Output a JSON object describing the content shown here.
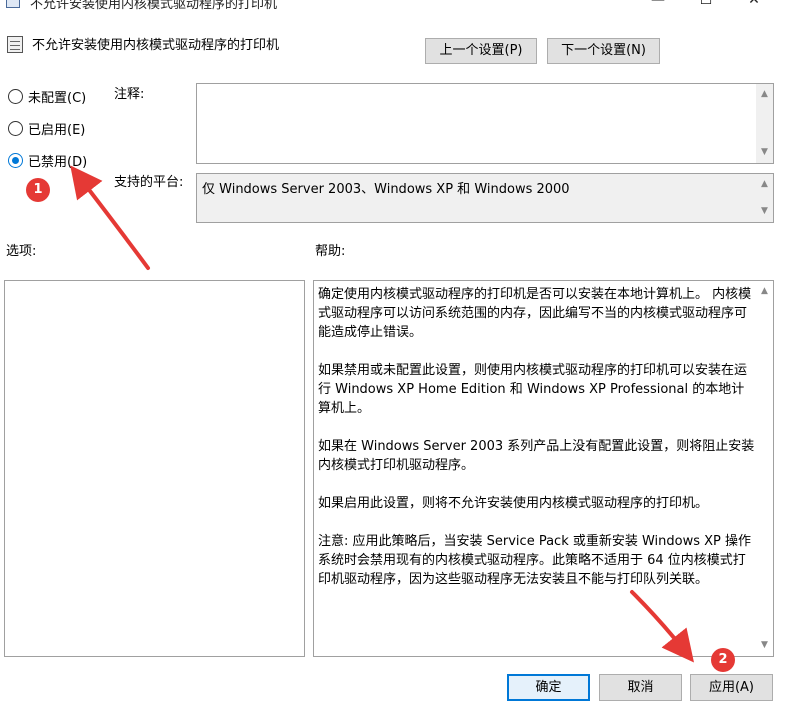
{
  "window": {
    "title": "不允许安装使用内核模式驱动程序的打印机",
    "controls": [
      "—",
      "☐",
      "✕"
    ]
  },
  "header": {
    "setting_title": "不允许安装使用内核模式驱动程序的打印机",
    "prev_button": "上一个设置(P)",
    "next_button": "下一个设置(N)"
  },
  "state": {
    "options": [
      {
        "label": "未配置(C)",
        "checked": false
      },
      {
        "label": "已启用(E)",
        "checked": false
      },
      {
        "label": "已禁用(D)",
        "checked": true
      }
    ]
  },
  "comment": {
    "label": "注释:",
    "value": ""
  },
  "platform": {
    "label": "支持的平台:",
    "value": "仅 Windows Server 2003、Windows XP 和 Windows 2000"
  },
  "options_panel": {
    "label": "选项:"
  },
  "help": {
    "label": "帮助:",
    "paragraphs": [
      "确定使用内核模式驱动程序的打印机是否可以安装在本地计算机上。 内核模式驱动程序可以访问系统范围的内存，因此编写不当的内核模式驱动程序可能造成停止错误。",
      "如果禁用或未配置此设置，则使用内核模式驱动程序的打印机可以安装在运行 Windows XP Home Edition 和 Windows XP Professional 的本地计算机上。",
      "如果在 Windows Server 2003 系列产品上没有配置此设置，则将阻止安装内核模式打印机驱动程序。",
      "如果启用此设置，则将不允许安装使用内核模式驱动程序的打印机。",
      "注意: 应用此策略后，当安装 Service Pack 或重新安装 Windows XP 操作系统时会禁用现有的内核模式驱动程序。此策略不适用于 64 位内核模式打印机驱动程序，因为这些驱动程序无法安装且不能与打印队列关联。"
    ]
  },
  "footer": {
    "ok": "确定",
    "cancel": "取消",
    "apply": "应用(A)"
  },
  "annotations": {
    "badge1": "1",
    "badge2": "2",
    "color": "#e53935"
  }
}
